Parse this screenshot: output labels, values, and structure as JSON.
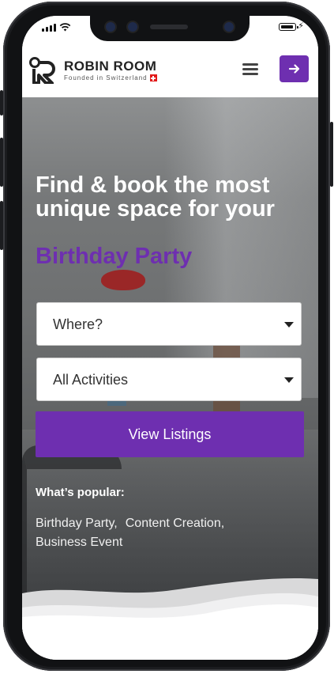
{
  "brand": {
    "name": "ROBIN ROOM",
    "tagline": "Founded in Switzerland",
    "accent_color": "#6e2fb0"
  },
  "header": {
    "menu_icon": "hamburger-menu-icon",
    "login_icon": "arrow-right-icon"
  },
  "hero": {
    "headline": "Find & book the most unique space for your",
    "headline_accent": "Birthday Party"
  },
  "search": {
    "location_select": {
      "selected": "Where?"
    },
    "activity_select": {
      "selected": "All Activities"
    },
    "submit_label": "View Listings"
  },
  "popular": {
    "label": "What’s popular:",
    "items": [
      "Birthday Party,",
      "Content Creation,",
      "Business Event"
    ]
  }
}
